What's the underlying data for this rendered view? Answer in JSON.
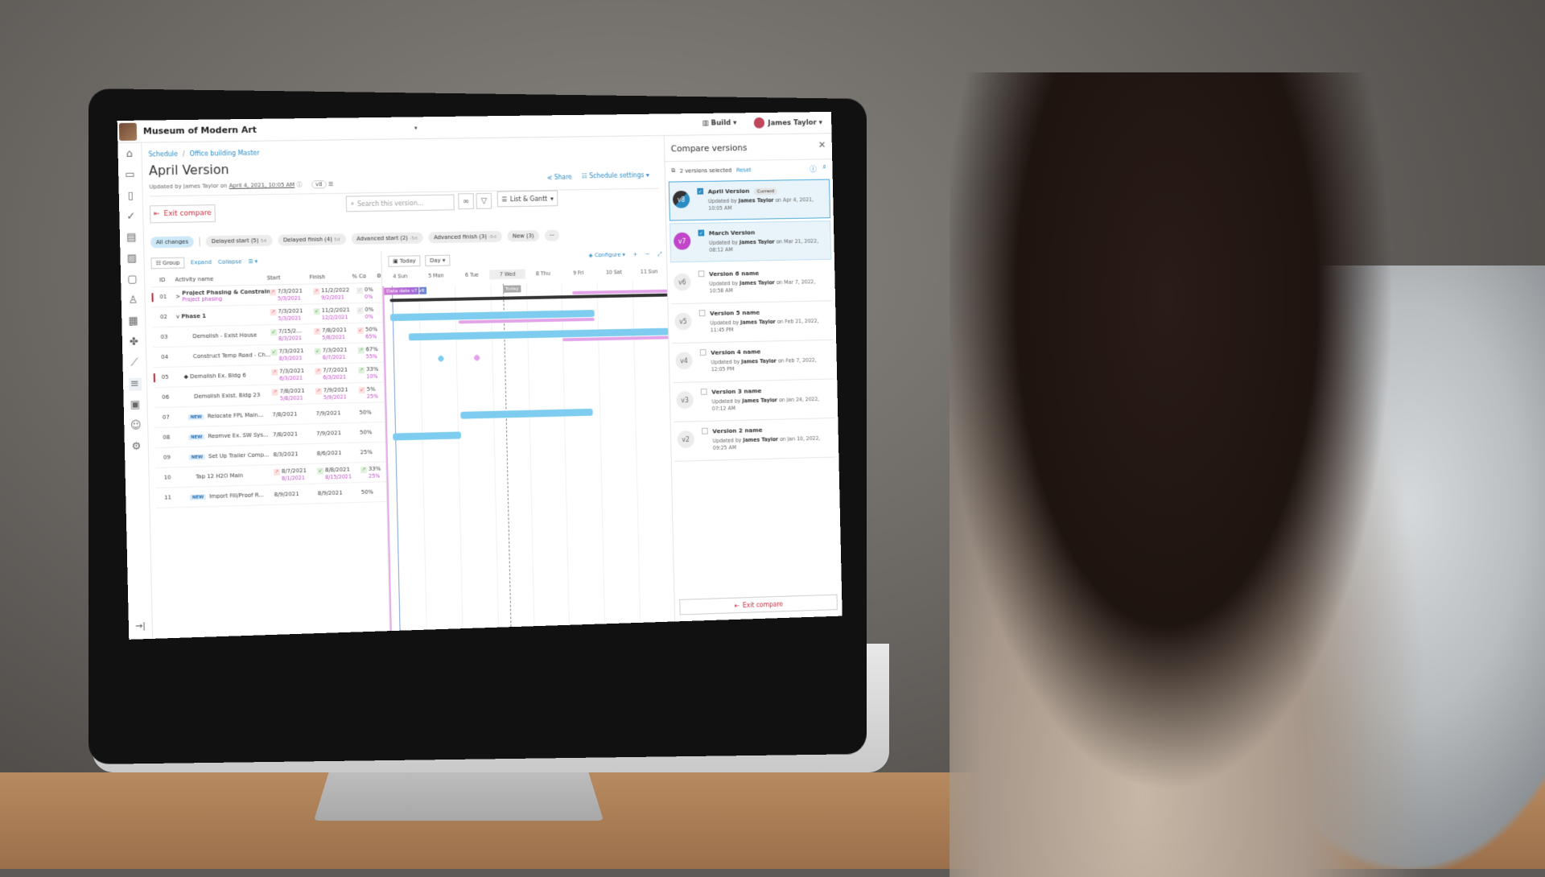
{
  "app": {
    "project_name": "Museum of Modern Art",
    "build_menu": "Build",
    "user_name": "James Taylor"
  },
  "nav": {
    "icons": [
      "home-icon",
      "sheets-icon",
      "document-icon",
      "check-circle-icon",
      "clipboard-icon",
      "photos-icon",
      "comment-icon",
      "stamp-icon",
      "calendar-people-icon",
      "fan-icon",
      "chart-icon",
      "schedule-icon",
      "report-icon",
      "team-icon",
      "settings-icon"
    ],
    "active_index": 11,
    "collapse_icon": "→|"
  },
  "header": {
    "breadcrumb": [
      "Schedule",
      "Office building Master"
    ],
    "title": "April Version",
    "updated_prefix": "Updated by James Taylor on",
    "updated_date": "April 4, 2021, 10:05 AM",
    "version_badge": "v8",
    "share_label": "Share",
    "settings_label": "Schedule settings"
  },
  "toolbar": {
    "exit_compare_label": "Exit compare",
    "search_placeholder": "Search this version...",
    "view_label": "List & Gantt"
  },
  "filters": [
    {
      "label": "All changes",
      "suffix": "",
      "active": true
    },
    {
      "label": "Delayed start (5)",
      "suffix": "5d"
    },
    {
      "label": "Delayed finish (4)",
      "suffix": "5d"
    },
    {
      "label": "Advanced start (2)",
      "suffix": "-5d"
    },
    {
      "label": "Advanced finish (3)",
      "suffix": "-5d"
    },
    {
      "label": "New (3)",
      "suffix": ""
    },
    {
      "label": "···",
      "suffix": ""
    }
  ],
  "grid_tools": {
    "group_label": "Group",
    "expand_label": "Expand",
    "collapse_label": "Collapse"
  },
  "table": {
    "columns": [
      "ID",
      "Activity name",
      "Start",
      "Finish",
      "% Co"
    ],
    "rows": [
      {
        "id": "01",
        "name": "Project Phasing & Constraints",
        "sub": "Project phasing",
        "start": "7/3/2021",
        "start_prev": "5/3/2021",
        "start_trend": "up",
        "finish": "11/2/2022",
        "finish_prev": "9/2/2021",
        "finish_trend": "up",
        "pct": "0%",
        "pct_prev": "0%",
        "pct_trend": "nc",
        "flag": true,
        "expander": ">"
      },
      {
        "id": "02",
        "name": "Phase 1",
        "start": "7/3/2021",
        "start_prev": "5/3/2021",
        "start_trend": "up",
        "finish": "11/2/2021",
        "finish_prev": "12/2/2021",
        "finish_trend": "down",
        "pct": "0%",
        "pct_prev": "0%",
        "pct_trend": "nc",
        "expander": "v"
      },
      {
        "id": "03",
        "name": "Demolish - Exist House",
        "start": "7/15/2...",
        "start_prev": "8/3/2021",
        "start_trend": "down",
        "finish": "7/8/2021",
        "finish_prev": "5/8/2021",
        "finish_trend": "up",
        "pct": "50%",
        "pct_prev": "65%",
        "pct_trend": "upred"
      },
      {
        "id": "04",
        "name": "Construct Temp Road - Ch...",
        "start": "7/3/2021",
        "start_prev": "8/3/2021",
        "start_trend": "down",
        "finish": "7/3/2021",
        "finish_prev": "8/7/2021",
        "finish_trend": "down",
        "pct": "67%",
        "pct_prev": "55%",
        "pct_trend": "upgreen"
      },
      {
        "id": "05",
        "name": "Demolish Ex. Bldg 6",
        "milestone": true,
        "start": "7/3/2021",
        "start_prev": "6/3/2021",
        "start_trend": "up",
        "finish": "7/7/2021",
        "finish_prev": "6/3/2021",
        "finish_trend": "up",
        "pct": "33%",
        "pct_prev": "10%",
        "pct_trend": "upgreen",
        "flag": true
      },
      {
        "id": "06",
        "name": "Demolish Exist. Bldg 23",
        "start": "7/8/2021",
        "start_prev": "5/8/2021",
        "start_trend": "up",
        "finish": "7/9/2021",
        "finish_prev": "5/9/2021",
        "finish_trend": "up",
        "pct": "5%",
        "pct_prev": "25%",
        "pct_trend": "upred"
      },
      {
        "id": "07",
        "name": "Relocate FPL Main...",
        "new": true,
        "start": "7/8/2021",
        "finish": "7/9/2021",
        "pct": "50%"
      },
      {
        "id": "08",
        "name": "Reomve Ex. SW Sys...",
        "new": true,
        "start": "7/8/2021",
        "finish": "7/9/2021",
        "pct": "50%"
      },
      {
        "id": "09",
        "name": "Set Up Trailer Comp...",
        "new": true,
        "start": "8/3/2021",
        "finish": "8/6/2021",
        "pct": "25%"
      },
      {
        "id": "10",
        "name": "Tap 12 H2O Main",
        "start": "8/7/2021",
        "start_prev": "8/1/2021",
        "start_trend": "up",
        "finish": "8/8/2021",
        "finish_prev": "8/15/2021",
        "finish_trend": "down",
        "pct": "33%",
        "pct_prev": "25%",
        "pct_trend": "upgreen"
      },
      {
        "id": "11",
        "name": "Import Fill/Proof R...",
        "new": true,
        "start": "8/9/2021",
        "finish": "8/9/2021",
        "pct": "50%"
      }
    ],
    "new_tag": "NEW"
  },
  "gantt": {
    "today_label": "Today",
    "scale_label": "Day",
    "configure_label": "Configure",
    "days": [
      "4 Sun",
      "5 Mon",
      "6 Tue",
      "7 Wed",
      "8 Thu",
      "9 Fri",
      "10 Sat",
      "11 Sun"
    ],
    "today_index": 3,
    "data_date_label": "Data date v7",
    "data_date_v8": "v8",
    "today_tag": "Today",
    "colors": {
      "current": "#7ecdf0",
      "previous": "#e3a3e8",
      "summary": "#333333"
    },
    "bars": [
      {
        "row": 0,
        "type": "summary",
        "start": 0.2,
        "end": 8.0
      },
      {
        "row": 0,
        "type": "previous",
        "start": 5.3,
        "end": 8.0
      },
      {
        "row": 1,
        "type": "current",
        "start": 0.2,
        "end": 5.9
      },
      {
        "row": 1,
        "type": "previous",
        "start": 2.1,
        "end": 5.9
      },
      {
        "row": 2,
        "type": "current",
        "start": 0.7,
        "end": 8.0
      },
      {
        "row": 2,
        "type": "previous",
        "start": 5.0,
        "end": 8.0
      },
      {
        "row": 3,
        "type": "milestone-current",
        "start": 1.5
      },
      {
        "row": 3,
        "type": "milestone-previous",
        "start": 2.5
      },
      {
        "row": 6,
        "type": "current",
        "start": 2.1,
        "end": 5.8
      },
      {
        "row": 7,
        "type": "current",
        "start": 0.2,
        "end": 2.1
      }
    ]
  },
  "compare_panel": {
    "title": "Compare versions",
    "selected_text": "2 versions selected",
    "reset_label": "Reset",
    "current_tag": "Current",
    "updated_by": "Updated by",
    "versions": [
      {
        "badge": "v8",
        "name": "April Version",
        "user": "James Taylor",
        "date": "on Apr 4, 2021, 10:05 AM",
        "checked": true,
        "current": true
      },
      {
        "badge": "v7",
        "name": "March Version",
        "user": "James Taylor",
        "date": "on Mar 21, 2022, 08:12 AM",
        "checked": true
      },
      {
        "badge": "v6",
        "name": "Version 6 name",
        "user": "James Taylor",
        "date": "on Mar 7, 2022, 10:58 AM",
        "checked": false
      },
      {
        "badge": "v5",
        "name": "Version 5 name",
        "user": "James Taylor",
        "date": "on Feb 21, 2022, 11:45 PM",
        "checked": false
      },
      {
        "badge": "v4",
        "name": "Version 4 name",
        "user": "James Taylor",
        "date": "on Feb 7, 2022, 12:05 PM",
        "checked": false
      },
      {
        "badge": "v3",
        "name": "Version 3 name",
        "user": "James Taylor",
        "date": "on Jan 24, 2022, 07:12 AM",
        "checked": false
      },
      {
        "badge": "v2",
        "name": "Version 2 name",
        "user": "James Taylor",
        "date": "on Jan 10, 2022, 09:25 AM",
        "checked": false
      }
    ],
    "exit_compare_label": "Exit compare"
  }
}
